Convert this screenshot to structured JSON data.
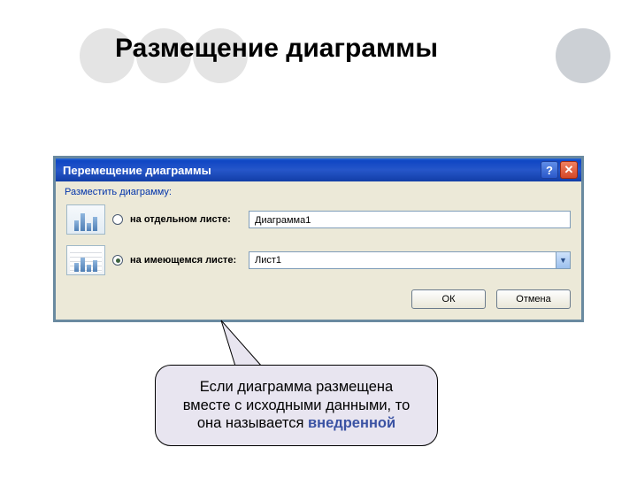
{
  "slide": {
    "title": "Размещение диаграммы"
  },
  "dialog": {
    "title": "Перемещение диаграммы",
    "group_label": "Разместить диаграмму:",
    "option_separate": {
      "label": "на отдельном листе:",
      "value": "Диаграмма1"
    },
    "option_existing": {
      "label": "на имеющемся листе:",
      "value": "Лист1"
    },
    "ok": "ОК",
    "cancel": "Отмена"
  },
  "callout": {
    "line1": "Если диаграмма размещена",
    "line2": "вместе с исходными данными, то",
    "line3_prefix": "она называется ",
    "emph": "внедренной"
  }
}
